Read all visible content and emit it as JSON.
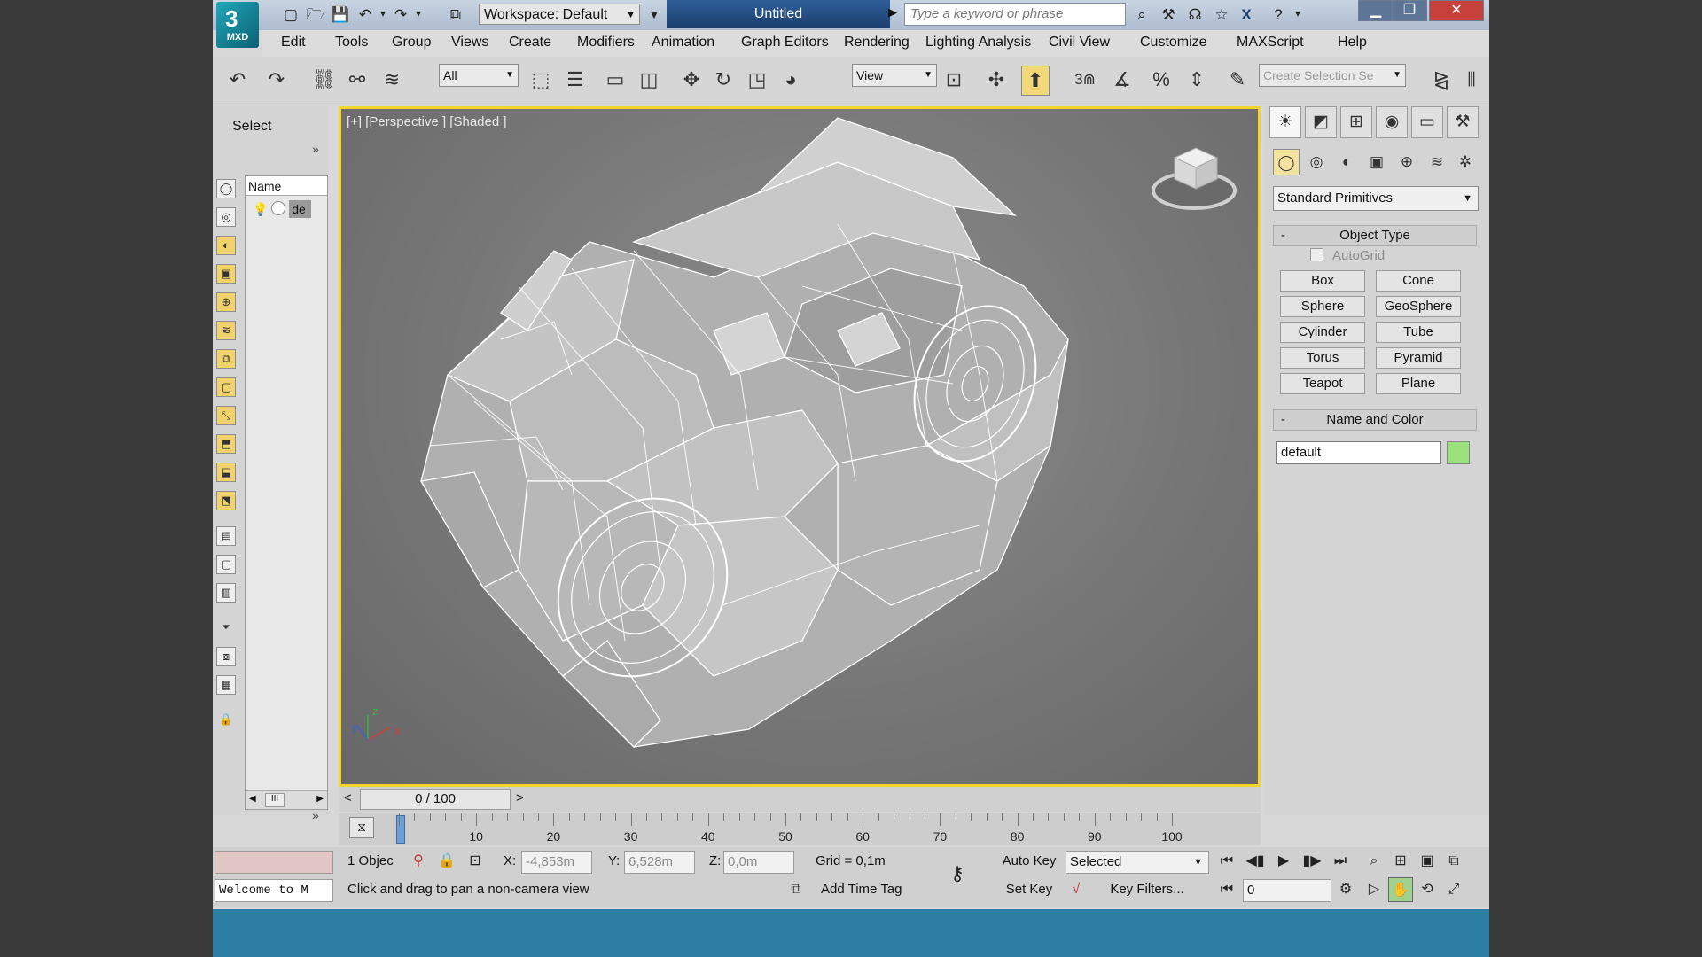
{
  "app": {
    "logo_text": "MXD",
    "workspace": "Workspace: Default",
    "title": "Untitled",
    "search_placeholder": "Type a keyword or phrase"
  },
  "menu": [
    "Edit",
    "Tools",
    "Group",
    "Views",
    "Create",
    "Modifiers",
    "Animation",
    "Graph Editors",
    "Rendering",
    "Lighting Analysis",
    "Civil View",
    "Customize",
    "MAXScript",
    "Help"
  ],
  "toolbar": {
    "filter": "All",
    "ref_coord": "View",
    "snap_label": "3",
    "selection_set_placeholder": "Create Selection Se"
  },
  "left_panel": {
    "title": "Select",
    "expand": "»",
    "scene_header": "Name",
    "scene_item": "de",
    "scroll_thumb": "III"
  },
  "viewport": {
    "label": "[+] [Perspective ] [Shaded ]",
    "gizmo": {
      "x": "x",
      "y": "y",
      "z": "z"
    }
  },
  "command_panel": {
    "category": "Standard Primitives",
    "object_type_title": "Object Type",
    "autogrid": "AutoGrid",
    "primitives": [
      "Box",
      "Cone",
      "Sphere",
      "GeoSphere",
      "Cylinder",
      "Tube",
      "Torus",
      "Pyramid",
      "Teapot",
      "Plane"
    ],
    "name_color_title": "Name and Color",
    "object_name": "default",
    "object_color": "#9be27f",
    "collapse": "-"
  },
  "timeline": {
    "frame_display": "0 / 100",
    "prev": "<",
    "next": ">",
    "ticks": [
      0,
      10,
      20,
      30,
      40,
      50,
      60,
      70,
      80,
      90,
      100
    ],
    "tick_labels": [
      "10",
      "20",
      "30",
      "40",
      "50",
      "60",
      "70",
      "80",
      "90",
      "100"
    ],
    "current_frame": 0
  },
  "status": {
    "selected_count": "1 Objec",
    "x_label": "X:",
    "x_value": "-4,853m",
    "y_label": "Y:",
    "y_value": "6,528m",
    "z_label": "Z:",
    "z_value": "0,0m",
    "grid": "Grid = 0,1m",
    "auto_key": "Auto Key",
    "set_key": "Set Key",
    "selected_dd": "Selected",
    "key_filters": "Key Filters...",
    "add_time_tag": "Add Time Tag",
    "prompt": "Click and drag to pan a non-camera view",
    "frame_field": "0",
    "maxscript_listener": "Welcome to M"
  },
  "colors": {
    "viewport_border": "#f2d42a",
    "title_active": "#1c3f6e",
    "taskbar": "#2d7ea5"
  }
}
